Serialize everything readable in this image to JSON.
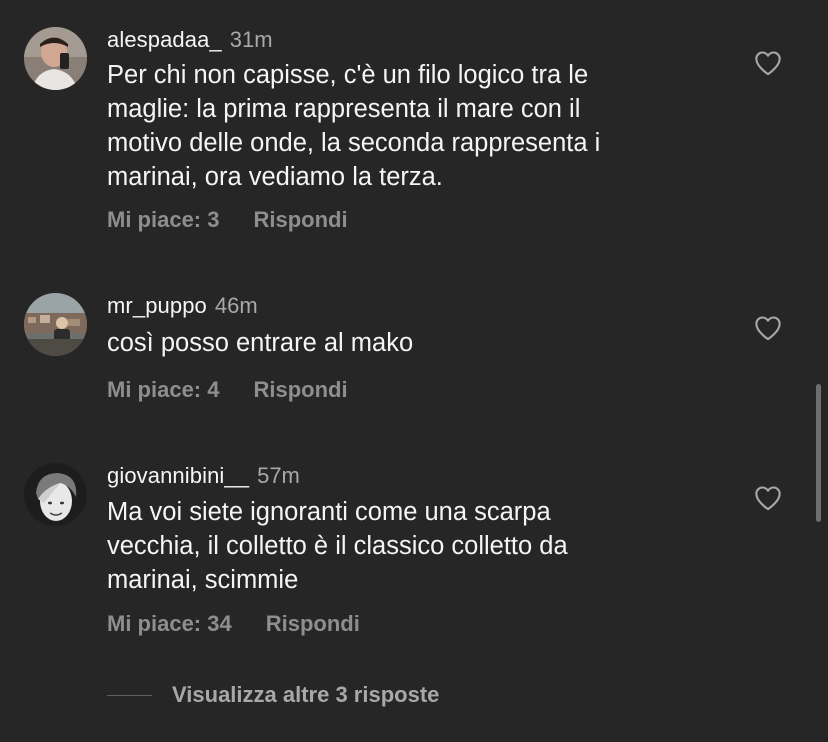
{
  "comments": [
    {
      "username": "alespadaa_",
      "time": "31m",
      "text_lines": [
        "Per chi non capisse, c'è un filo logico tra le",
        "maglie: la prima rappresenta il mare con il",
        "motivo delle onde, la seconda rappresenta i",
        "marinai, ora vediamo la terza."
      ],
      "likes_label": "Mi piace: 3",
      "reply_label": "Rispondi",
      "avatar_icon": "user-avatar-icon"
    },
    {
      "username": "mr_puppo",
      "time": "46m",
      "text_lines": [
        "così posso entrare al mako"
      ],
      "likes_label": "Mi piace: 4",
      "reply_label": "Rispondi",
      "avatar_icon": "user-avatar-icon"
    },
    {
      "username": "giovannibini__",
      "time": "57m",
      "text_lines": [
        "Ma voi siete ignoranti come una scarpa",
        "vecchia, il colletto è il classico colletto da",
        "marinai, scimmie"
      ],
      "likes_label": "Mi piace: 34",
      "reply_label": "Rispondi",
      "avatar_icon": "user-avatar-icon"
    }
  ],
  "more_replies_label": "Visualizza altre 3 risposte",
  "icons": {
    "like": "heart-outline-icon"
  },
  "colors": {
    "background": "#262626",
    "primary_text": "#f5f5f5",
    "secondary_text": "#a8a8a8",
    "action_text": "#8e8e8e"
  }
}
